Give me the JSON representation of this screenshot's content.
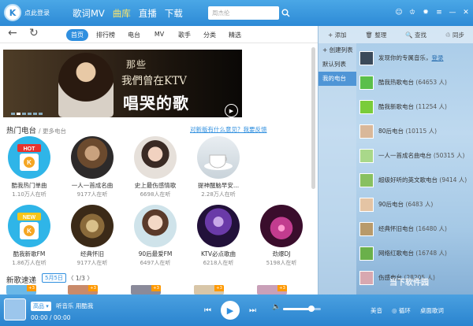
{
  "app": {
    "login_label": "点此登录",
    "logo_letter": "K"
  },
  "nav": {
    "items": [
      "歌词MV",
      "曲库",
      "直播",
      "下载"
    ],
    "active": 1
  },
  "search": {
    "placeholder": "周杰伦"
  },
  "window_icons": [
    "skin-icon",
    "shirt-icon",
    "gear-icon",
    "menu-icon",
    "minimize-icon",
    "close-icon"
  ],
  "toolbar": {
    "back_icon": "←",
    "refresh_icon": "↻",
    "tabs": [
      "首页",
      "排行榜",
      "电台",
      "MV",
      "歌手",
      "分类",
      "精选"
    ],
    "active_tab": 0
  },
  "banner": {
    "line1": "那些",
    "line2": "我們曾在KTV",
    "line3": "唱哭的歌",
    "slide_count": 6,
    "active_slide": 1
  },
  "radio_section": {
    "title": "热门电台",
    "more": "/ 更多电台",
    "feedback": "对新版有什么意见？我要反馈",
    "row1": [
      {
        "name": "酷我热门单曲",
        "count": "1.10万人在听"
      },
      {
        "name": "一人一首成名曲",
        "count": "9177人在听"
      },
      {
        "name": "史上最伤感情歌",
        "count": "6698人在听"
      },
      {
        "name": "提神醒脑早安...",
        "count": "2.28万人在听"
      }
    ],
    "row2": [
      {
        "name": "酷我新歌FM",
        "count": "1.86万人在听"
      },
      {
        "name": "经典怀旧",
        "count": "9177人在听"
      },
      {
        "name": "90后最爱FM",
        "count": "6497人在听"
      },
      {
        "name": "KTV必点歌曲",
        "count": "6218人在听"
      },
      {
        "name": "劲爆DJ",
        "count": "5198人在听"
      }
    ]
  },
  "new_songs": {
    "title": "新歌速递",
    "date": "5月5日",
    "pager": "〈 1/3 〉",
    "badge": "+3"
  },
  "right_panel": {
    "tools": [
      "+ 添加",
      "🗑 整理",
      "🔍 查找",
      "♲ 同步"
    ],
    "nav": [
      "+ 创建列表",
      "默认列表",
      "我的电台"
    ],
    "nav_selected": 2,
    "first_item": {
      "text": "发现你的专属音乐，",
      "link": "登录"
    },
    "items": [
      {
        "name": "酷我热歌电台",
        "count": "(64653 人)"
      },
      {
        "name": "酷我新歌电台",
        "count": "(11254 人)"
      },
      {
        "name": "80后电台",
        "count": "(10115 人)"
      },
      {
        "name": "一人一首成名曲电台",
        "count": "(50315 人)"
      },
      {
        "name": "超级好听的英文歌电台",
        "count": "(9414 人)"
      },
      {
        "name": "90后电台",
        "count": "(6483 人)"
      },
      {
        "name": "经典怀旧电台",
        "count": "(16480 人)"
      },
      {
        "name": "网络红歌电台",
        "count": "(16748 人)"
      },
      {
        "name": "伤感电台",
        "count": "(28205 人)"
      }
    ]
  },
  "watermark": "当下软件园",
  "player": {
    "quality": "高品 ▾",
    "title": "听音乐 用酷我",
    "time": "00:00 / 00:00",
    "prev_icon": "⏮",
    "play_icon": "▶",
    "next_icon": "⏭",
    "volume_icon": "🔈",
    "volume": 0.75,
    "mode": "美音",
    "playlist": "◎ 循环",
    "lyrics": "桌面歌词"
  }
}
